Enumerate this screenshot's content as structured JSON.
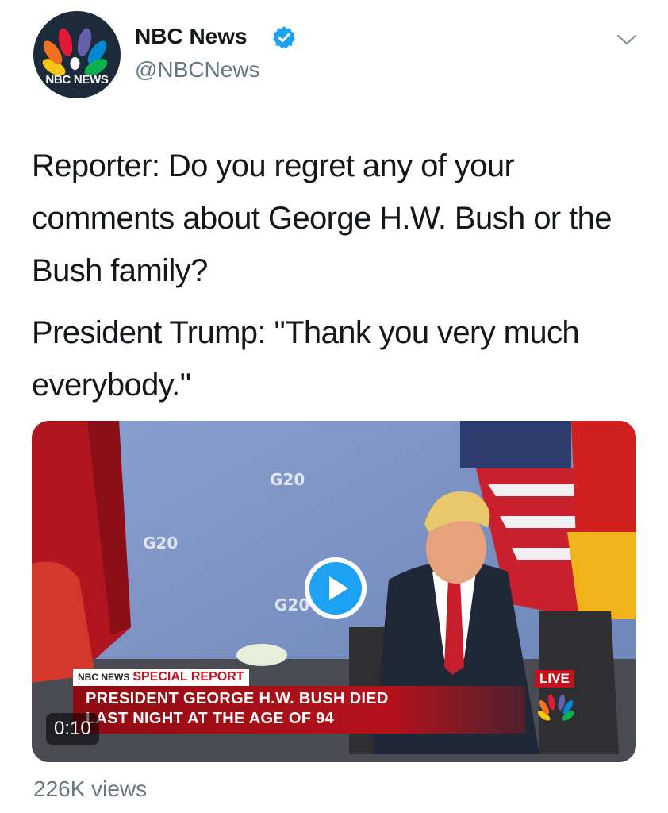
{
  "author": {
    "avatar_text": "NBC NEWS",
    "name": "NBC News",
    "handle": "@NBCNews",
    "verified": true
  },
  "icons": {
    "verified": "verified-badge-icon",
    "menu": "chevron-down-icon",
    "play": "play-icon"
  },
  "tweet": {
    "paragraphs": [
      "Reporter: Do you regret any of your comments about George H.W. Bush or the Bush family?",
      "President Trump: \"Thank you very much everybody.\""
    ]
  },
  "video": {
    "backdrop_logo": "G20",
    "brand_label": "NBC NEWS",
    "special_report": "SPECIAL REPORT",
    "headline_line1": "PRESIDENT GEORGE H.W. BUSH DIED",
    "headline_line2": "LAST NIGHT AT THE AGE OF 94",
    "live": "LIVE",
    "duration": "0:10"
  },
  "stats": {
    "views": "226K views"
  },
  "colors": {
    "verified": "#1da1f2",
    "text": "#14171a",
    "secondary": "#657786",
    "report_red": "#c2121c"
  }
}
